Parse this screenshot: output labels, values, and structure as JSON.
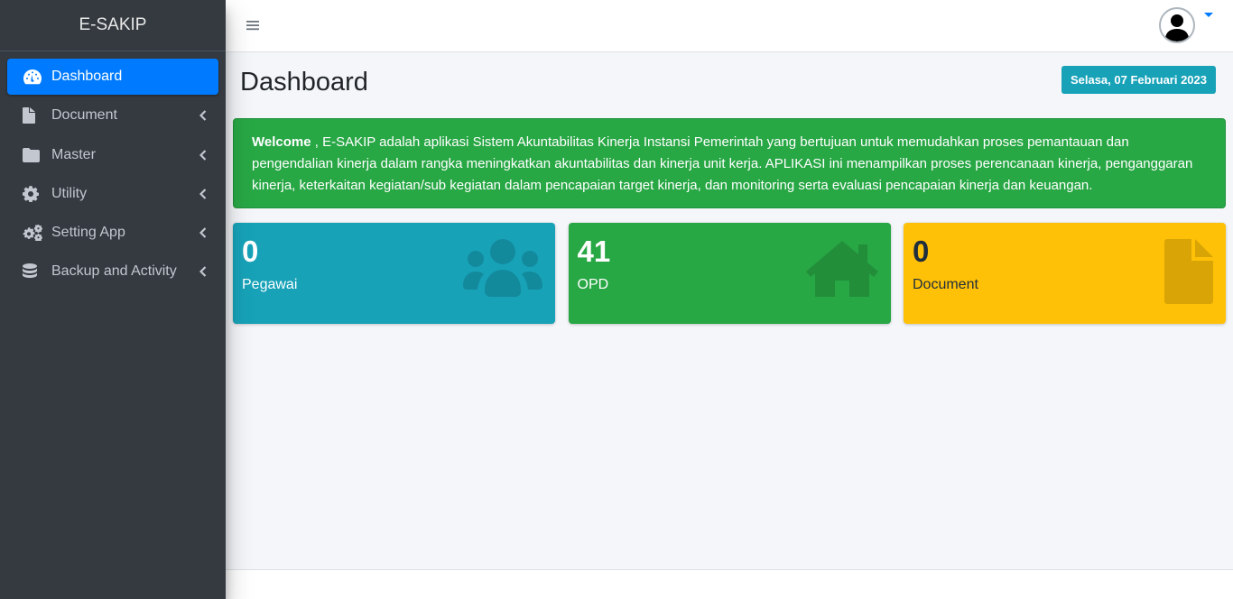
{
  "brand": {
    "title": "E-SAKIP"
  },
  "sidebar": {
    "items": [
      {
        "label": "Dashboard",
        "icon": "tachometer-icon",
        "active": true
      },
      {
        "label": "Document",
        "icon": "file-icon"
      },
      {
        "label": "Master",
        "icon": "folder-icon"
      },
      {
        "label": "Utility",
        "icon": "gear-icon"
      },
      {
        "label": "Setting App",
        "icon": "gears-icon"
      },
      {
        "label": "Backup and Activity",
        "icon": "database-icon"
      }
    ]
  },
  "header": {
    "page_title": "Dashboard",
    "date": "Selasa, 07 Februari 2023"
  },
  "welcome": {
    "bold": "Welcome",
    "text": " , E-SAKIP adalah aplikasi Sistem Akuntabilitas Kinerja Instansi Pemerintah yang bertujuan untuk memudahkan proses pemantauan dan pengendalian kinerja dalam rangka meningkatkan akuntabilitas dan kinerja unit kerja. APLIKASI ini menampilkan proses perencanaan kinerja, penganggaran kinerja, keterkaitan kegiatan/sub kegiatan dalam pencapaian target kinerja, dan monitoring serta evaluasi pencapaian kinerja dan keuangan."
  },
  "stats": [
    {
      "value": "0",
      "label": "Pegawai",
      "icon": "users-icon",
      "color": "#17a2b8"
    },
    {
      "value": "41",
      "label": "OPD",
      "icon": "home-icon",
      "color": "#28a745"
    },
    {
      "value": "0",
      "label": "Document",
      "icon": "file-icon",
      "color": "#ffc107"
    }
  ],
  "colors": {
    "sidebar": "#343a40",
    "active": "#007bff",
    "info": "#17a2b8",
    "success": "#28a745",
    "warning": "#ffc107"
  }
}
